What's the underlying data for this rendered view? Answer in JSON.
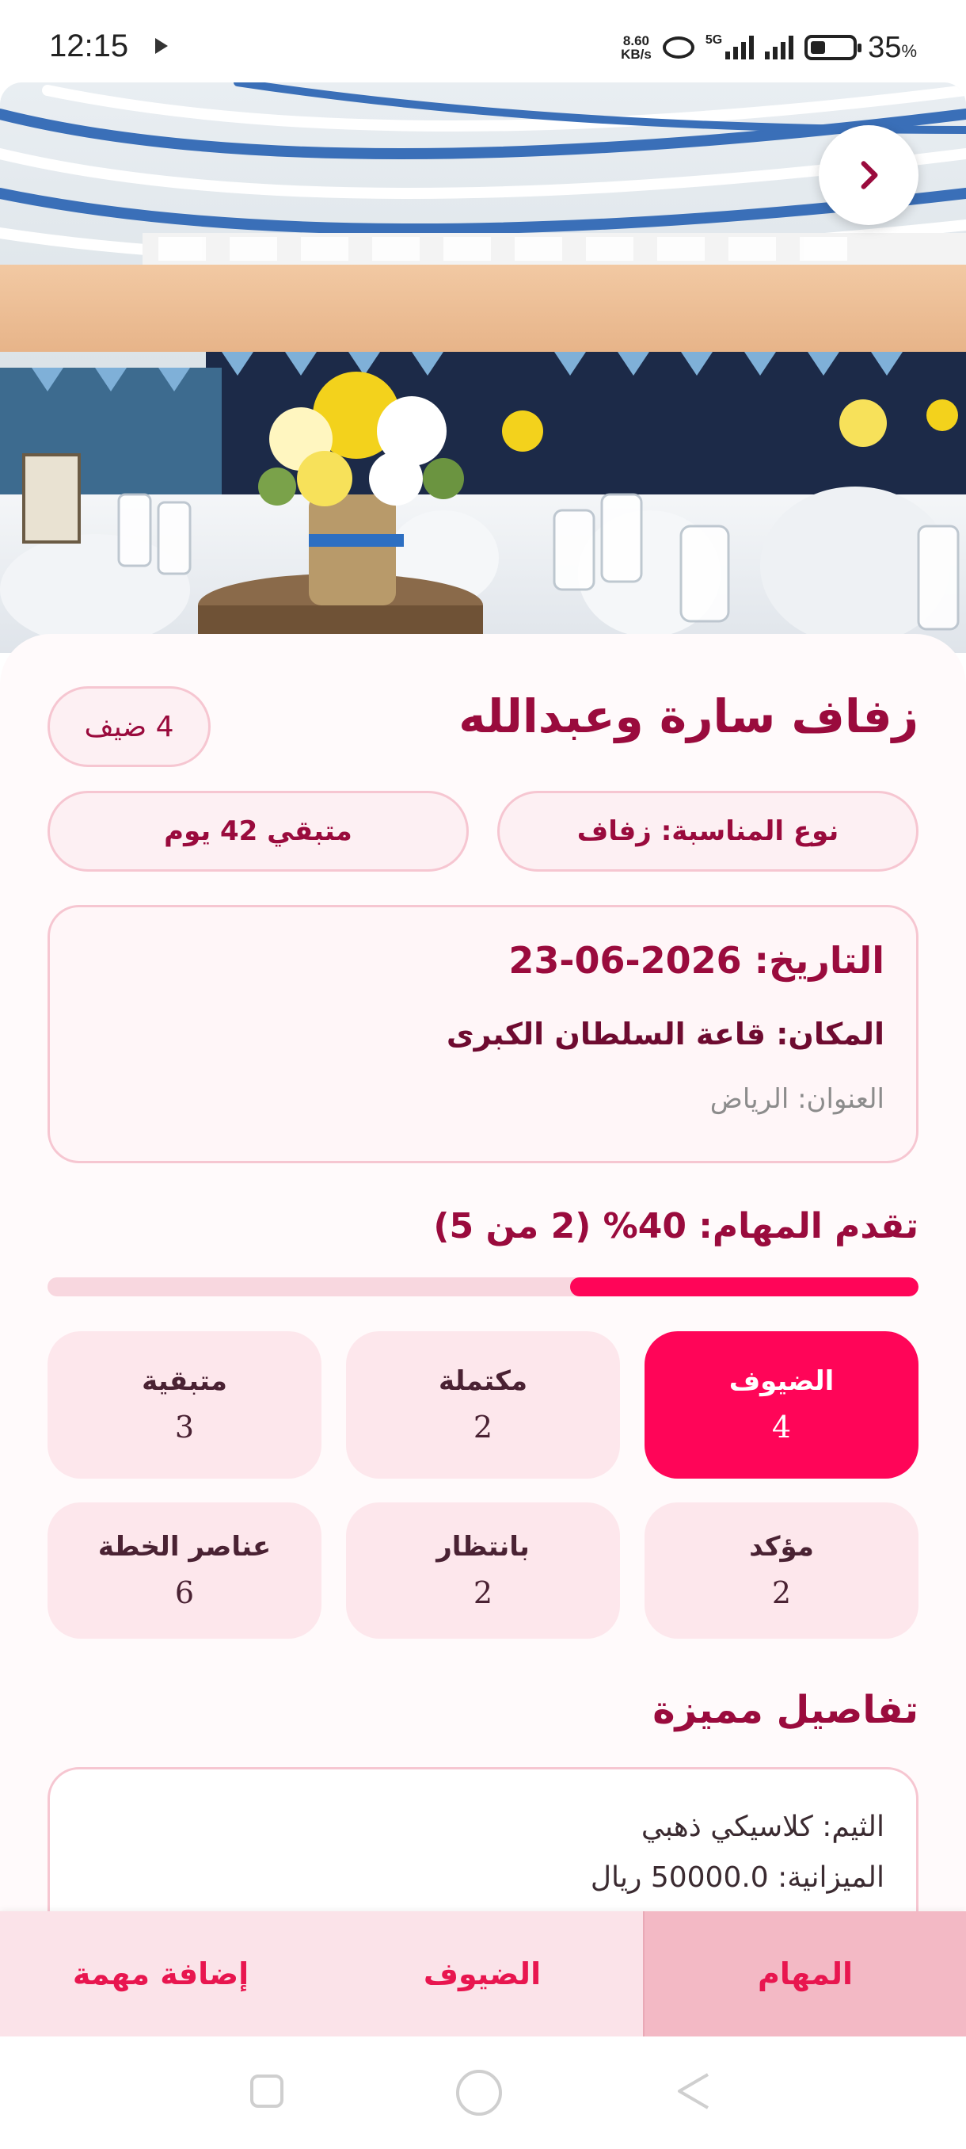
{
  "status_bar": {
    "time": "12:15",
    "net_speed_value": "8.60",
    "net_speed_unit": "KB/s",
    "network_type": "5G",
    "battery_percent": "35",
    "battery_unit": "%"
  },
  "event": {
    "title": "زفاف سارة وعبدالله",
    "guest_count_label": "4 ضيف",
    "type_label": "نوع المناسبة: زفاف",
    "remaining_label": "متبقي 42 يوم",
    "date_label": "التاريخ: 2026-06-23",
    "venue_label": "المكان: قاعة السلطان الكبرى",
    "address_label": "العنوان: الرياض"
  },
  "progress": {
    "title": "تقدم المهام: 40% (2 من 5)",
    "fraction": 0.4
  },
  "stats": [
    {
      "label": "الضيوف",
      "value": "4",
      "active": true
    },
    {
      "label": "مكتملة",
      "value": "2",
      "active": false
    },
    {
      "label": "متبقية",
      "value": "3",
      "active": false
    },
    {
      "label": "مؤكد",
      "value": "2",
      "active": false
    },
    {
      "label": "بانتظار",
      "value": "2",
      "active": false
    },
    {
      "label": "عناصر الخطة",
      "value": "6",
      "active": false
    }
  ],
  "features": {
    "title": "تفاصيل مميزة",
    "theme_label": "الثيم: كلاسيكي ذهبي",
    "budget_label": "الميزانية: 50000.0 ريال"
  },
  "bottom_nav": [
    {
      "label": "المهام",
      "active": true
    },
    {
      "label": "الضيوف",
      "active": false
    },
    {
      "label": "إضافة مهمة",
      "active": false
    }
  ],
  "colors": {
    "primary": "#ff0558",
    "title": "#9a0b3d",
    "pill_bg": "#fdf0f3",
    "pill_border": "#f6c6d1",
    "stat_bg": "#fde7ec",
    "nav_bg": "#fbe3e9",
    "nav_active_bg": "#f3b9c5"
  },
  "icons": {
    "back": "chevron-right-icon",
    "play": "play-icon",
    "link": "link-icon",
    "signal": "signal-icon",
    "battery": "battery-icon"
  }
}
